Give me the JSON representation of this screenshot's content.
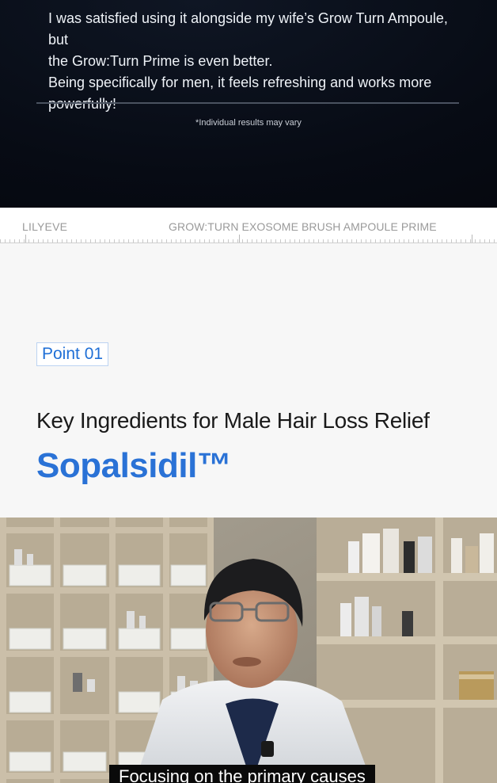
{
  "review": {
    "lines": [
      "I was satisfied using it alongside my wife’s Grow Turn Ampoule, but",
      "the Grow:Turn Prime is even better.",
      "Being specifically for men, it feels refreshing and works more",
      "powerfully!"
    ],
    "disclaimer": "*Individual results may vary"
  },
  "brand_bar": {
    "brand": "LILYEVE",
    "product": "GROW:TURN EXOSOME BRUSH AMPOULE PRIME"
  },
  "point": {
    "badge": "Point 01",
    "title": "Key Ingredients for Male Hair Loss Relief",
    "ingredient": "Sopalsidil™"
  },
  "video": {
    "caption": "Focusing on the primary causes"
  },
  "colors": {
    "accent_blue": "#2a72d6",
    "dark_bg": "#070b14"
  }
}
